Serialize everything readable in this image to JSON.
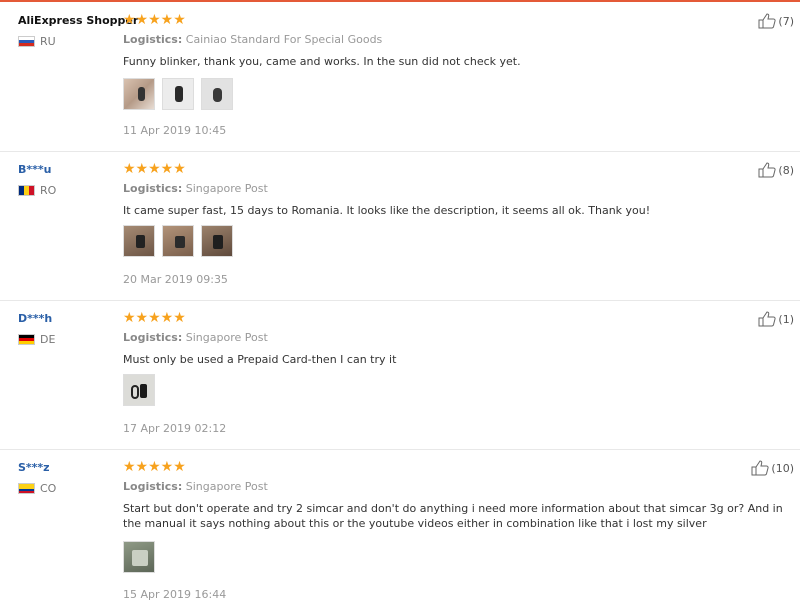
{
  "header": {
    "accent": "#e45a38"
  },
  "reviews": [
    {
      "user": "AliExpress Shopper",
      "country": "RU",
      "flag": "russia-flag",
      "rating": "★★★★★",
      "logistics_label": "Logistics:",
      "logistics": "Cainiao Standard For Special Goods",
      "text": "Funny blinker, thank you, came and works. In the sun did not check yet.",
      "photos": 3,
      "date": "11 Apr 2019 10:45",
      "likes": "(7)"
    },
    {
      "user": "B***u",
      "country": "RO",
      "flag": "romania-flag",
      "rating": "★★★★★",
      "logistics_label": "Logistics:",
      "logistics": "Singapore Post",
      "text": "It came super fast, 15 days to Romania. It looks like the description, it seems all ok. Thank you!",
      "photos": 3,
      "date": "20 Mar 2019 09:35",
      "likes": "(8)"
    },
    {
      "user": "D***h",
      "country": "DE",
      "flag": "germany-flag",
      "rating": "★★★★★",
      "logistics_label": "Logistics:",
      "logistics": "Singapore Post",
      "text": "Must only be used a Prepaid Card-then I can try it",
      "photos": 1,
      "date": "17 Apr 2019 02:12",
      "likes": "(1)"
    },
    {
      "user": "S***z",
      "country": "CO",
      "flag": "colombia-flag",
      "rating": "★★★★★",
      "logistics_label": "Logistics:",
      "logistics": "Singapore Post",
      "text": "Start but don't operate and try 2 simcar and don't do anything i need more information about that simcar 3g or? And in the manual it says nothing about this or the youtube videos either in combination like that i lost my silver",
      "photos": 1,
      "date": "15 Apr 2019 16:44",
      "likes": "(10)"
    }
  ],
  "colors": {
    "star": "#f7a21e",
    "masked_user": "#2a5fa7"
  }
}
